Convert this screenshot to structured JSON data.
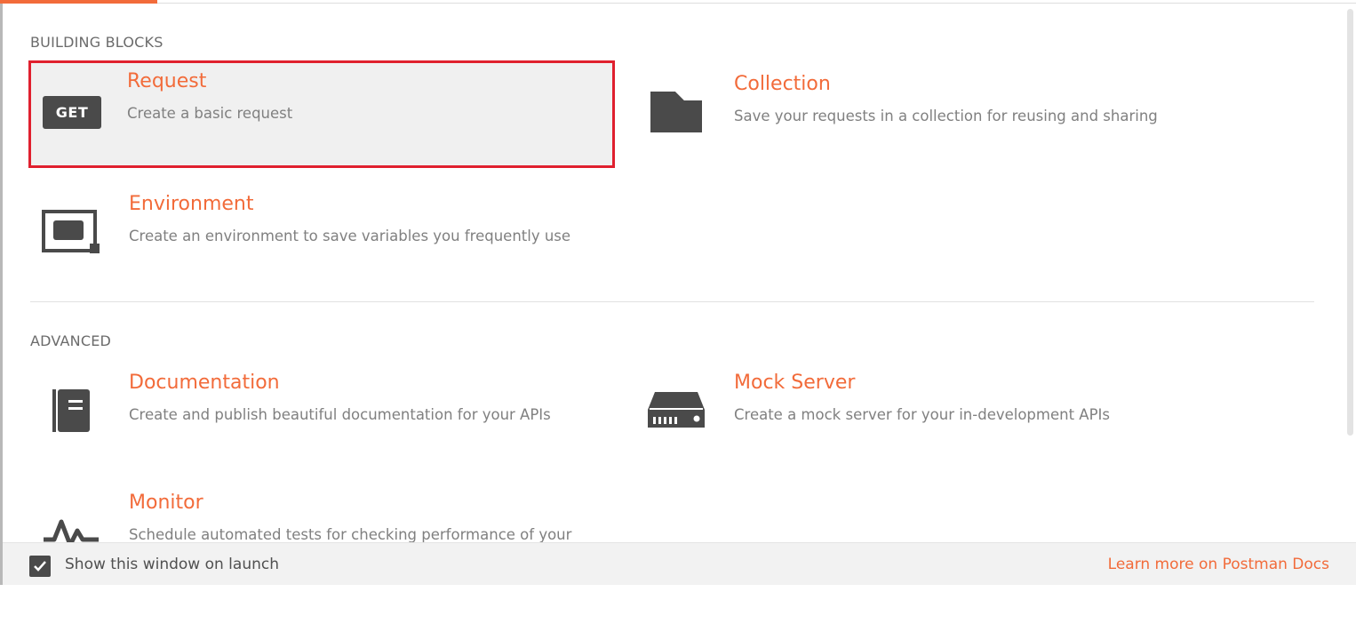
{
  "sections": {
    "building_blocks": {
      "title": "BUILDING BLOCKS",
      "items": {
        "request": {
          "title": "Request",
          "description": "Create a basic request",
          "badge": "GET",
          "icon": "get-badge-icon",
          "selected": true
        },
        "collection": {
          "title": "Collection",
          "description": "Save your requests in a collection for reusing and sharing",
          "icon": "folder-icon"
        },
        "environment": {
          "title": "Environment",
          "description": "Create an environment to save variables you frequently use",
          "icon": "environment-icon"
        }
      }
    },
    "advanced": {
      "title": "ADVANCED",
      "items": {
        "documentation": {
          "title": "Documentation",
          "description": "Create and publish beautiful documentation for your APIs",
          "icon": "book-icon"
        },
        "mock_server": {
          "title": "Mock Server",
          "description": "Create a mock server for your in-development APIs",
          "icon": "server-icon"
        },
        "monitor": {
          "title": "Monitor",
          "description": "Schedule automated tests for checking performance of your",
          "icon": "pulse-icon"
        }
      }
    }
  },
  "footer": {
    "checkbox_label": "Show this window on launch",
    "checkbox_checked": true,
    "docs_link": "Learn more on Postman Docs"
  },
  "colors": {
    "accent": "#f26b3a",
    "selection_border": "#e0202e",
    "icon": "#4a4a4a"
  }
}
